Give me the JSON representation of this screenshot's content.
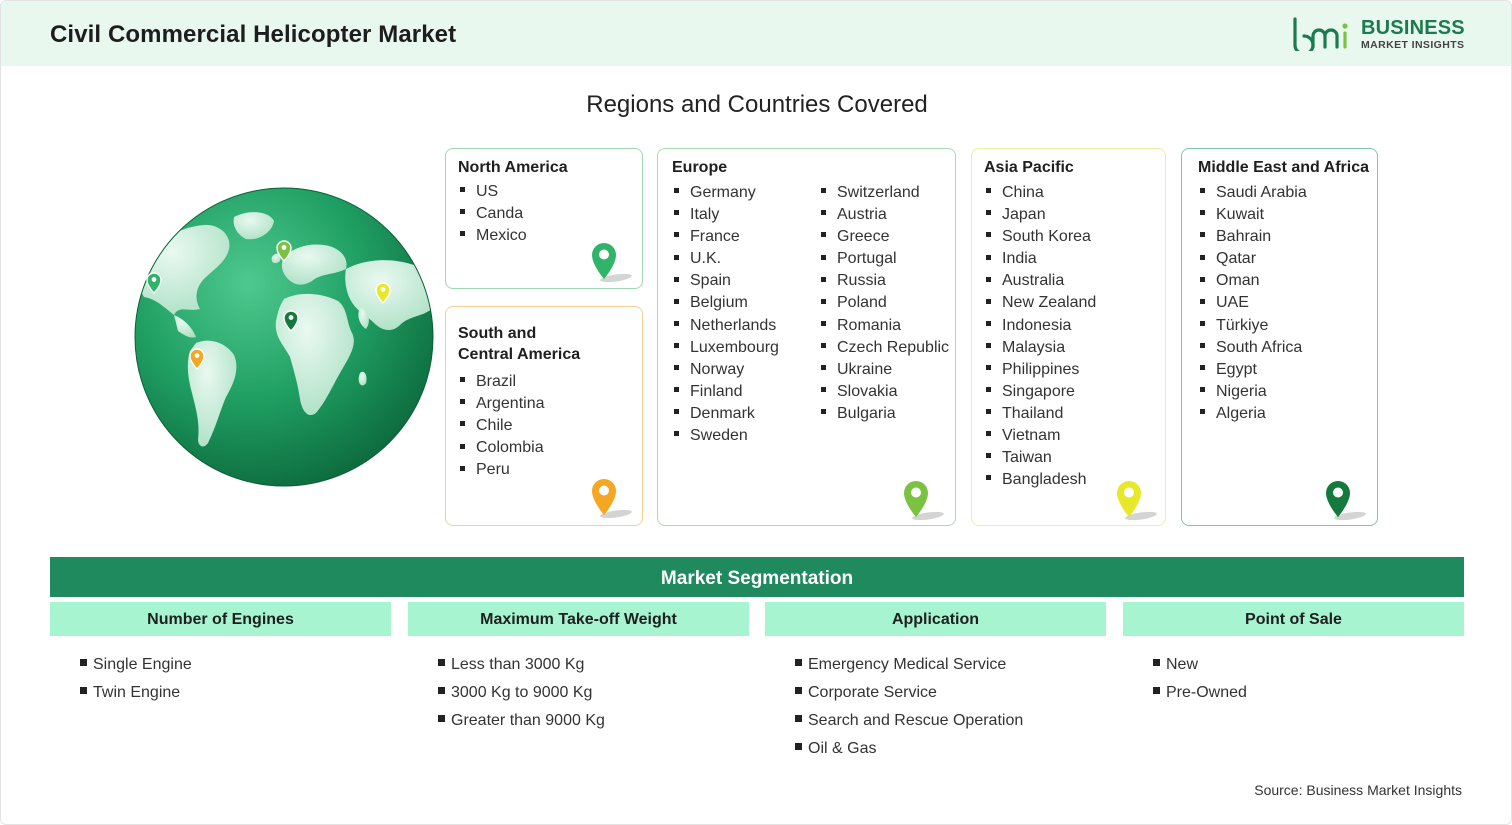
{
  "header": {
    "title": "Civil Commercial Helicopter Market",
    "logo": {
      "line1": "BUSINESS",
      "line2": "MARKET INSIGHTS",
      "color": "#1c7a4f"
    }
  },
  "regions": {
    "title": "Regions and Countries Covered",
    "north_america": {
      "name": "North America",
      "countries": [
        "US",
        "Canda",
        "Mexico"
      ],
      "pin_color": "#2fb469"
    },
    "south_central_america": {
      "name_line1": "South and",
      "name_line2": "Central America",
      "countries": [
        "Brazil",
        "Argentina",
        "Chile",
        "Colombia",
        "Peru"
      ],
      "pin_color": "#f5a623"
    },
    "europe": {
      "name": "Europe",
      "countries_col1": [
        "Germany",
        "Italy",
        "France",
        "U.K.",
        "Spain",
        "Belgium",
        "Netherlands",
        "Luxembourg",
        "Norway",
        "Finland",
        "Denmark",
        "Sweden"
      ],
      "countries_col2": [
        "Switzerland",
        "Austria",
        "Greece",
        "Portugal",
        "Russia",
        "Poland",
        "Romania",
        "Czech Republic",
        "Ukraine",
        "Slovakia",
        "Bulgaria"
      ],
      "pin_color": "#7cc242"
    },
    "asia_pacific": {
      "name": "Asia Pacific",
      "countries": [
        "China",
        "Japan",
        "South Korea",
        "India",
        "Australia",
        "New Zealand",
        "Indonesia",
        "Malaysia",
        "Philippines",
        "Singapore",
        "Thailand",
        "Vietnam",
        "Taiwan",
        "Bangladesh"
      ],
      "pin_color": "#e8e82a"
    },
    "middle_east_africa": {
      "name": "Middle East and Africa",
      "countries": [
        "Saudi Arabia",
        "Kuwait",
        "Bahrain",
        "Qatar",
        "Oman",
        "UAE",
        "Türkiye",
        "South Africa",
        "Egypt",
        "Nigeria",
        "Algeria"
      ],
      "pin_color": "#147a3c"
    }
  },
  "segmentation": {
    "title": "Market Segmentation",
    "columns": [
      {
        "header": "Number of Engines",
        "items": [
          "Single Engine",
          "Twin Engine"
        ]
      },
      {
        "header": "Maximum Take-off Weight",
        "items": [
          "Less than 3000 Kg",
          "3000 Kg to 9000 Kg",
          "Greater than 9000 Kg"
        ]
      },
      {
        "header": "Application",
        "items": [
          "Emergency Medical Service",
          "Corporate Service",
          "Search and Rescue Operation",
          "Oil & Gas"
        ]
      },
      {
        "header": "Point of Sale",
        "items": [
          "New",
          "Pre-Owned"
        ]
      }
    ]
  },
  "source": "Source: Business Market Insights"
}
